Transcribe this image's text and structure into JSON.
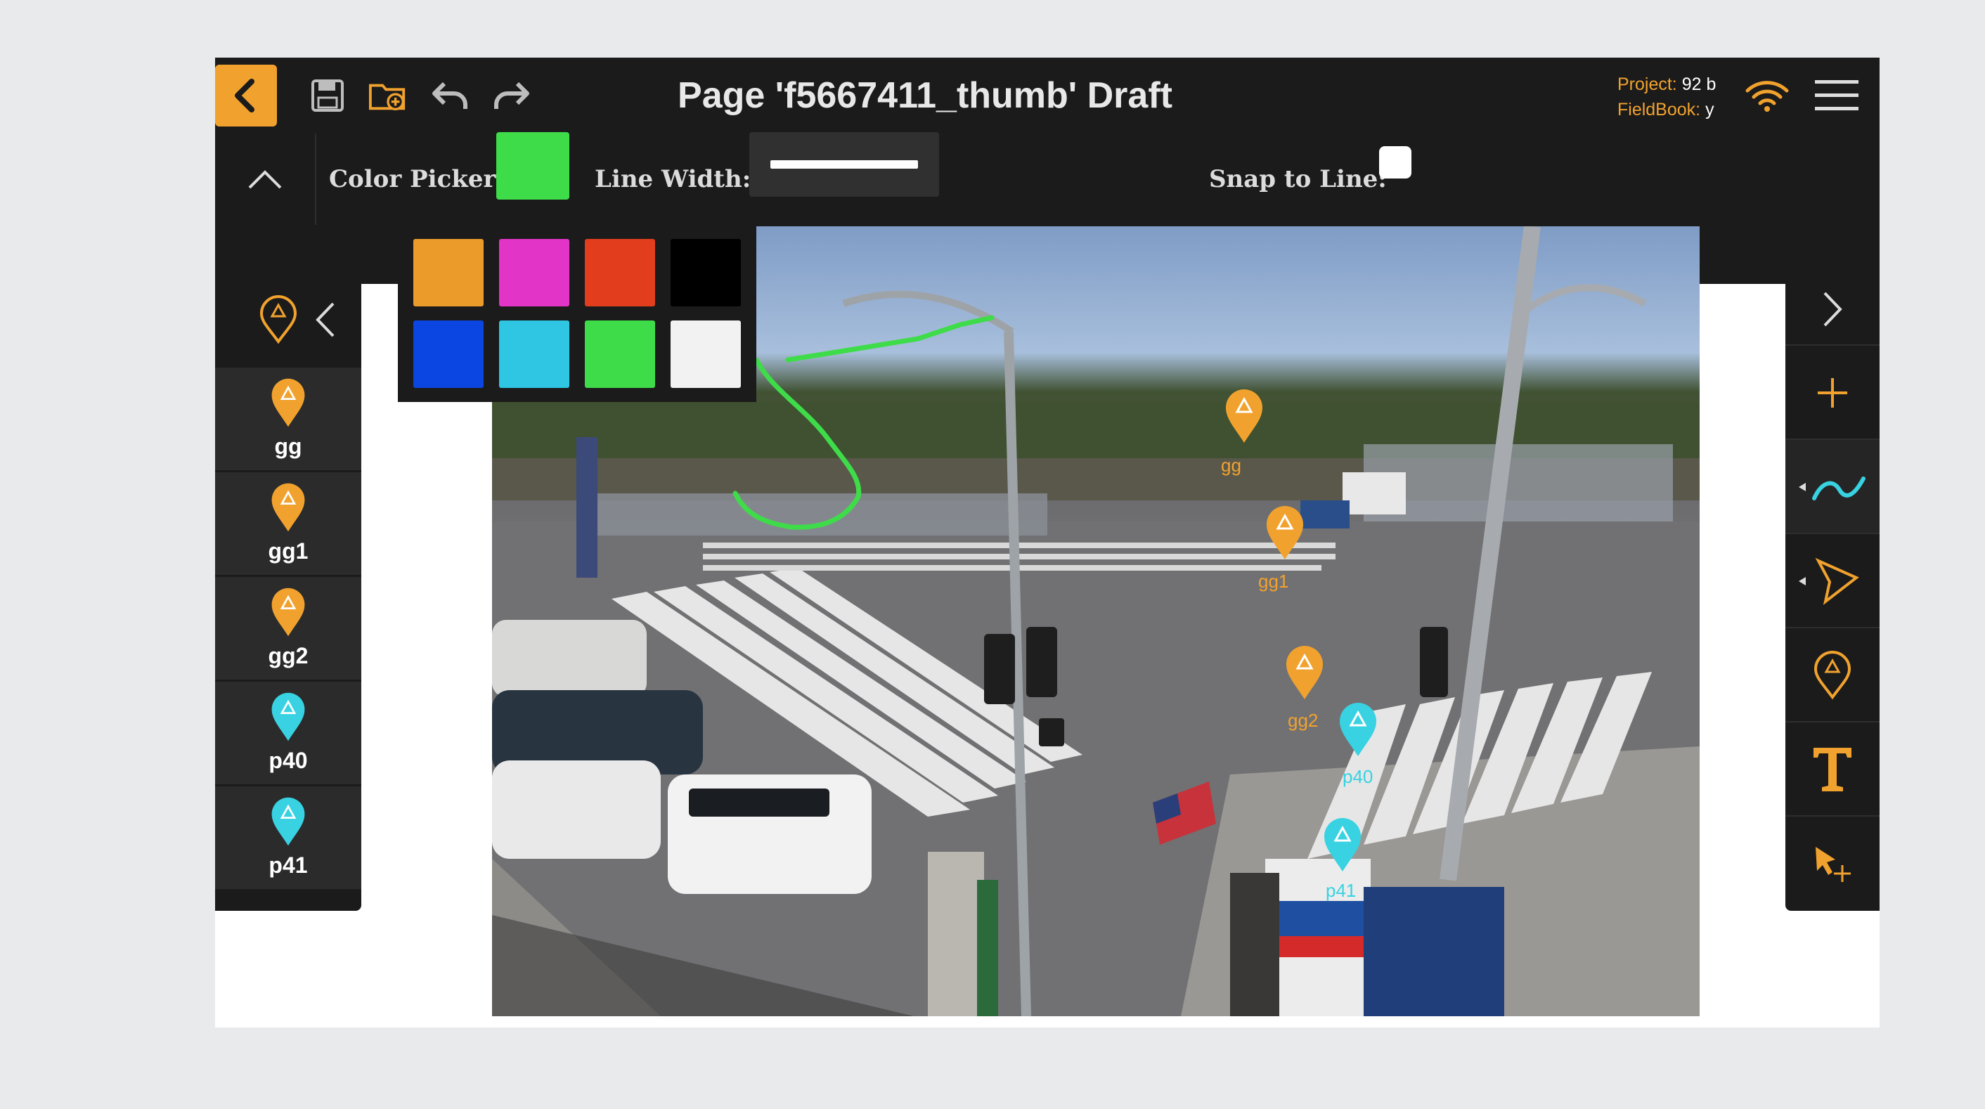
{
  "header": {
    "title": "Page 'f5667411_thumb' Draft",
    "project_label": "Project:",
    "project_value": "92 b",
    "fieldbook_label": "FieldBook:",
    "fieldbook_value": "y",
    "icons": [
      "back-arrow-icon",
      "save-icon",
      "folder-add-icon",
      "undo-icon",
      "redo-icon",
      "wifi-icon",
      "hamburger-menu-icon"
    ]
  },
  "toolbar": {
    "color_picker_label": "Color Picker:",
    "selected_color": "#3fdc4a",
    "line_width_label": "Line Width:",
    "snap_label": "Snap to Line:",
    "snap_checked": false
  },
  "palette": {
    "colors": [
      "#eb9b2a",
      "#e334c8",
      "#e23e1d",
      "#000000",
      "#0b45e2",
      "#2ec6e3",
      "#3fdc4a",
      "#f2f2f2"
    ]
  },
  "markers_panel": {
    "items": [
      {
        "label": "gg",
        "color": "#f1a22e"
      },
      {
        "label": "gg1",
        "color": "#f1a22e"
      },
      {
        "label": "gg2",
        "color": "#f1a22e"
      },
      {
        "label": "p40",
        "color": "#38d2e2"
      },
      {
        "label": "p41",
        "color": "#38d2e2"
      }
    ]
  },
  "map_labels": {
    "gg": "gg",
    "gg1": "gg1",
    "gg2": "gg2",
    "p40": "p40",
    "p41": "p41"
  },
  "tools_panel": {
    "icons": [
      "chevron-right-icon",
      "plus-icon",
      "freehand-line-icon",
      "polygon-icon",
      "marker-icon",
      "text-tool-icon",
      "select-move-icon"
    ],
    "active": "freehand-line-icon"
  },
  "colors": {
    "accent": "#f1a22e",
    "bar": "#1b1b1b",
    "drawing_line": "#3fdc4a",
    "cyan_marker": "#38d2e2"
  }
}
